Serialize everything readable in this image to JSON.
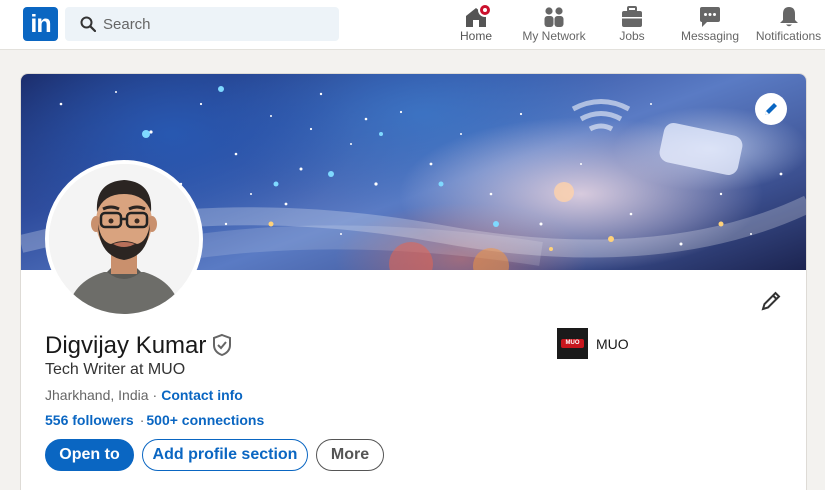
{
  "nav": {
    "logo_text": "in",
    "search_placeholder": "Search",
    "items": [
      {
        "label": "Home",
        "icon": "home-icon"
      },
      {
        "label": "My Network",
        "icon": "network-icon"
      },
      {
        "label": "Jobs",
        "icon": "briefcase-icon"
      },
      {
        "label": "Messaging",
        "icon": "chat-icon"
      },
      {
        "label": "Notifications",
        "icon": "bell-icon"
      }
    ],
    "home_badge": "notification-dot"
  },
  "profile": {
    "name": "Digvijay Kumar",
    "headline": "Tech Writer at MUO",
    "location": "Jharkhand, India",
    "location_separator": "·",
    "contact_label": "Contact info",
    "followers": "556 followers",
    "connections_separator": "·",
    "connections": "500+ connections",
    "company": {
      "name": "MUO",
      "logo_text": "MUO"
    },
    "buttons": {
      "open_to": "Open to",
      "add_section": "Add profile section",
      "more": "More"
    }
  },
  "colors": {
    "brand": "#0a66c2",
    "badge": "#cb112d",
    "page_bg": "#f3f2ef"
  }
}
